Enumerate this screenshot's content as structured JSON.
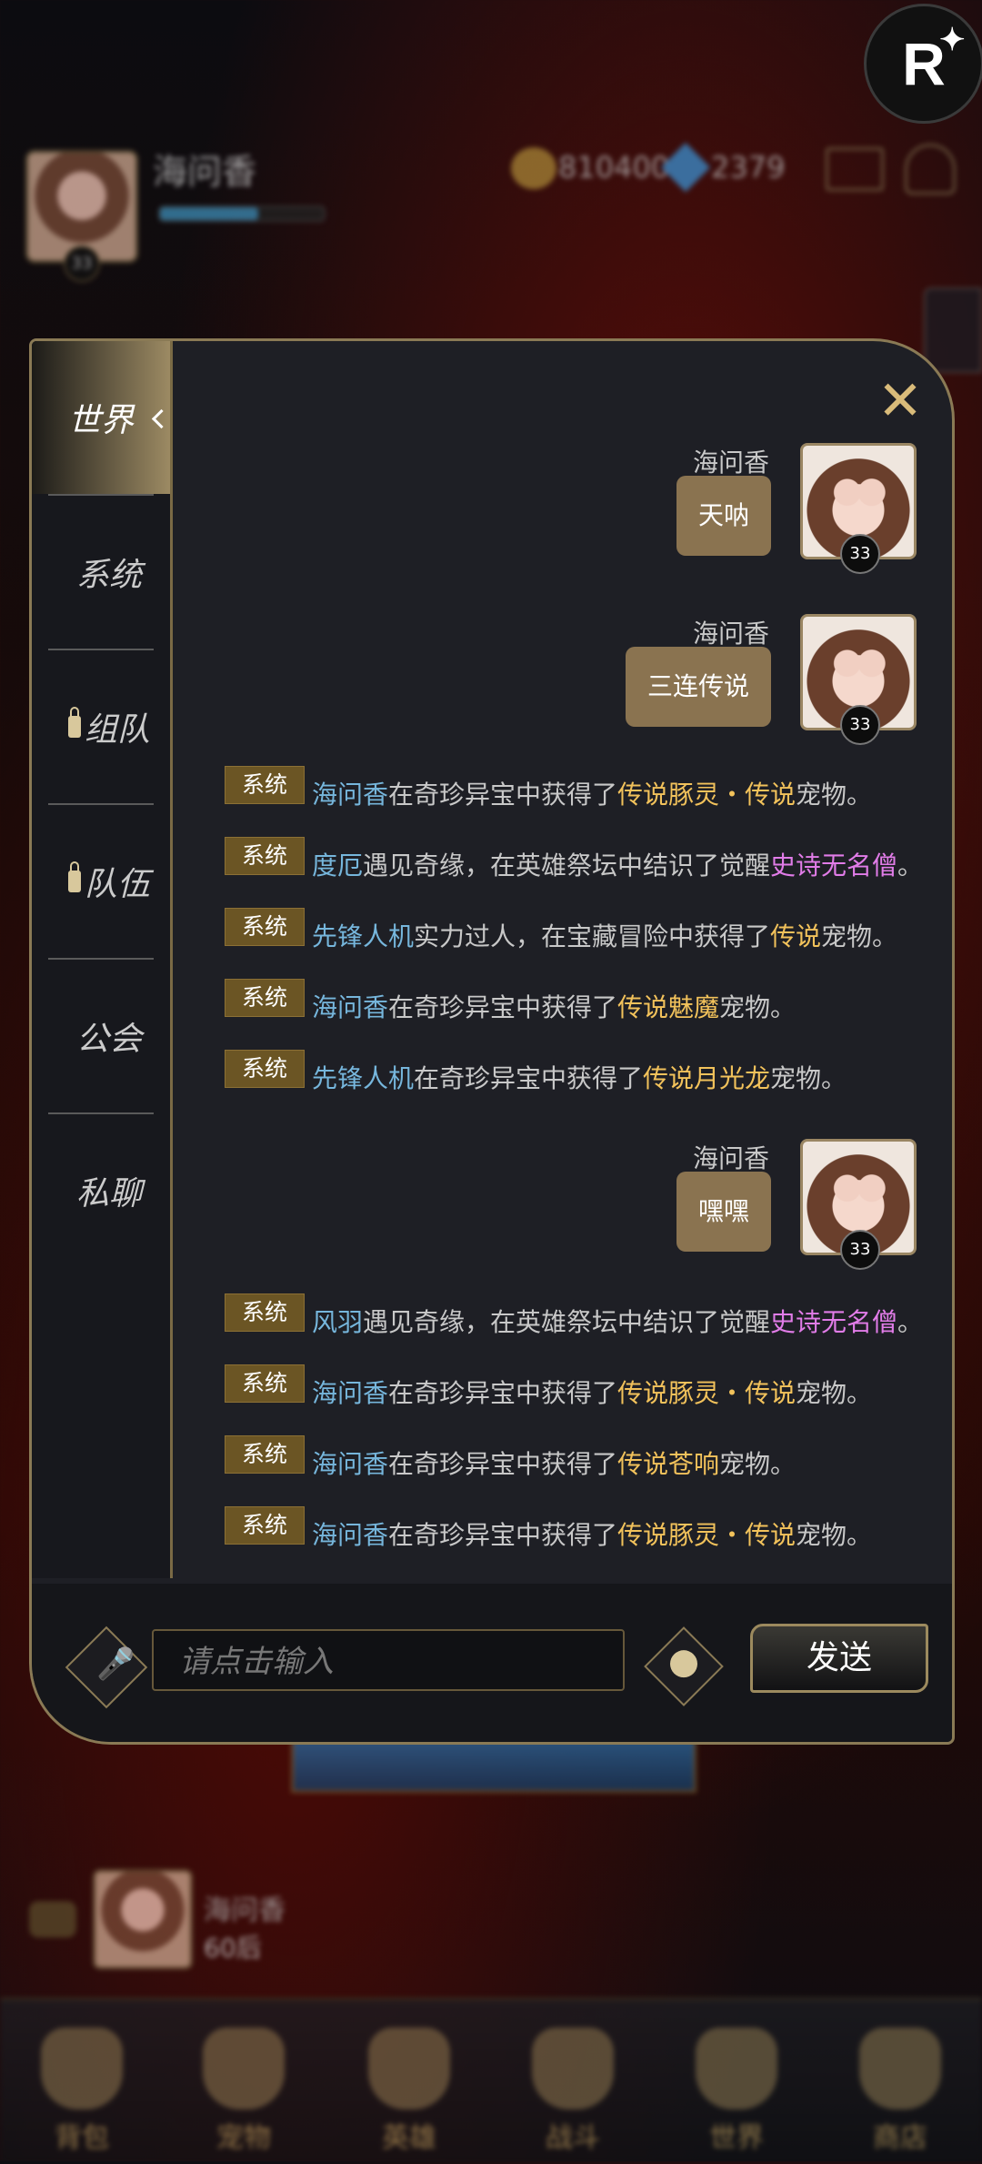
{
  "hud": {
    "player_name": "海问香",
    "level": "33",
    "gold": "810400",
    "gems": "2379",
    "xp_progress": 0.6,
    "mini_name": "海问香",
    "mini_sub": "60后"
  },
  "nav": [
    {
      "label": "背包",
      "icon": "backpack-icon"
    },
    {
      "label": "宠物",
      "icon": "paw-icon"
    },
    {
      "label": "英雄",
      "icon": "hero-icon"
    },
    {
      "label": "战斗",
      "icon": "swords-icon"
    },
    {
      "label": "世界",
      "icon": "world-icon"
    },
    {
      "label": "商店",
      "icon": "shop-icon"
    }
  ],
  "badge": {
    "letter": "R"
  },
  "chat": {
    "tabs": {
      "world": "世界",
      "system": "系统",
      "team": "组队",
      "squad": "队伍",
      "guild": "公会",
      "private": "私聊"
    },
    "close_glyph": "✕",
    "self_messages": [
      {
        "name": "海问香",
        "text": "天呐",
        "level": "33"
      },
      {
        "name": "海问香",
        "text": "三连传说",
        "level": "33"
      },
      {
        "name": "海问香",
        "text": "嘿嘿",
        "level": "33"
      }
    ],
    "system_label": "系统",
    "system_messages": [
      {
        "parts": [
          "海问香",
          "在奇珍异宝中获得了",
          "传说豚灵・传说",
          "宠物。"
        ]
      },
      {
        "parts": [
          "度厄",
          "遇见奇缘，在英雄祭坛中结识了觉醒",
          "史诗无名僧",
          "。"
        ]
      },
      {
        "parts": [
          "先锋人机",
          "实力过人，在宝藏冒险中获得了",
          "传说",
          "宠物。"
        ]
      },
      {
        "parts": [
          "海问香",
          "在奇珍异宝中获得了",
          "传说魅魔",
          "宠物。"
        ]
      },
      {
        "parts": [
          "先锋人机",
          "在奇珍异宝中获得了",
          "传说月光龙",
          "宠物。"
        ]
      },
      {
        "parts": [
          "风羽",
          "遇见奇缘，在英雄祭坛中结识了觉醒",
          "史诗无名僧",
          "。"
        ]
      },
      {
        "parts": [
          "海问香",
          "在奇珍异宝中获得了",
          "传说豚灵・传说",
          "宠物。"
        ]
      },
      {
        "parts": [
          "海问香",
          "在奇珍异宝中获得了",
          "传说苍响",
          "宠物。"
        ]
      },
      {
        "parts": [
          "海问香",
          "在奇珍异宝中获得了",
          "传说豚灵・传说",
          "宠物。"
        ]
      }
    ],
    "input_placeholder": "请点击输入",
    "send_label": "发送"
  },
  "colors": {
    "player_name": "#76b6dc",
    "legendary": "#f2c25b",
    "epic": "#e17ce8",
    "system_badge": "#6b5524",
    "bubble": "#8a7350"
  }
}
